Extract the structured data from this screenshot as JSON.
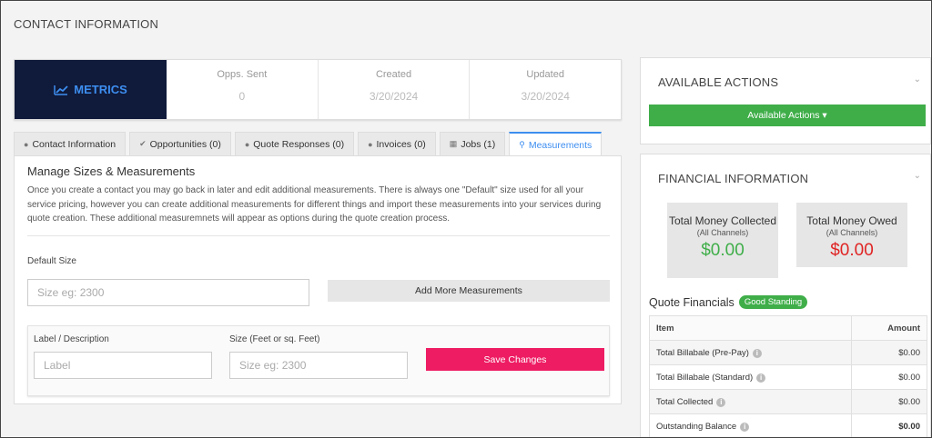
{
  "page": {
    "title": "CONTACT INFORMATION"
  },
  "metrics": {
    "title": "METRICS",
    "icon": "line-chart-icon",
    "items": [
      {
        "label": "Opps. Sent",
        "value": "0"
      },
      {
        "label": "Created",
        "value": "3/20/2024"
      },
      {
        "label": "Updated",
        "value": "3/20/2024"
      }
    ]
  },
  "tabs": [
    {
      "label": "Contact Information",
      "icon": "user-icon"
    },
    {
      "label": "Opportunities (0)",
      "icon": "check-icon"
    },
    {
      "label": "Quote Responses (0)",
      "icon": "comment-icon"
    },
    {
      "label": "Invoices (0)",
      "icon": "comment-icon"
    },
    {
      "label": "Jobs (1)",
      "icon": "calendar-icon"
    },
    {
      "label": "Measurements",
      "icon": "map-marker-icon",
      "active": true
    }
  ],
  "measurements": {
    "heading": "Manage Sizes & Measurements",
    "description": "Once you create a contact you may go back in later and edit additional measurements. There is always one \"Default\" size used for all your service pricing, however you can create additional measurements for different things and import these measurements into your services during quote creation. These additional measuremnets will appear as options during the quote creation process.",
    "default_size_label": "Default Size",
    "default_size_placeholder": "Size eg: 2300",
    "add_more_label": "Add More Measurements",
    "label_desc_label": "Label / Description",
    "label_placeholder": "Label",
    "size_label": "Size (Feet or sq. Feet)",
    "size_placeholder": "Size eg: 2300",
    "save_label": "Save Changes"
  },
  "actions": {
    "title": "AVAILABLE ACTIONS",
    "button_label": "Available Actions ▾"
  },
  "financial": {
    "title": "FINANCIAL INFORMATION",
    "collected": {
      "title": "Total Money Collected",
      "sub": "(All Channels)",
      "value": "$0.00",
      "color": "#3fae49"
    },
    "owed": {
      "title": "Total Money Owed",
      "sub": "(All Channels)",
      "value": "$0.00",
      "color": "#e02424"
    },
    "quote_title": "Quote Financials",
    "badge": "Good Standing",
    "table": {
      "headers": [
        "Item",
        "Amount"
      ],
      "rows": [
        {
          "item": "Total Billabale (Pre-Pay)",
          "amount": "$0.00"
        },
        {
          "item": "Total Billabale (Standard)",
          "amount": "$0.00"
        },
        {
          "item": "Total Collected",
          "amount": "$0.00"
        },
        {
          "item": "Outstanding Balance",
          "amount": "$0.00"
        }
      ]
    }
  },
  "colors": {
    "accent": "#3d8ef0",
    "save": "#ee1c63",
    "green": "#3fae49",
    "metrics_bg": "#101a3a"
  }
}
